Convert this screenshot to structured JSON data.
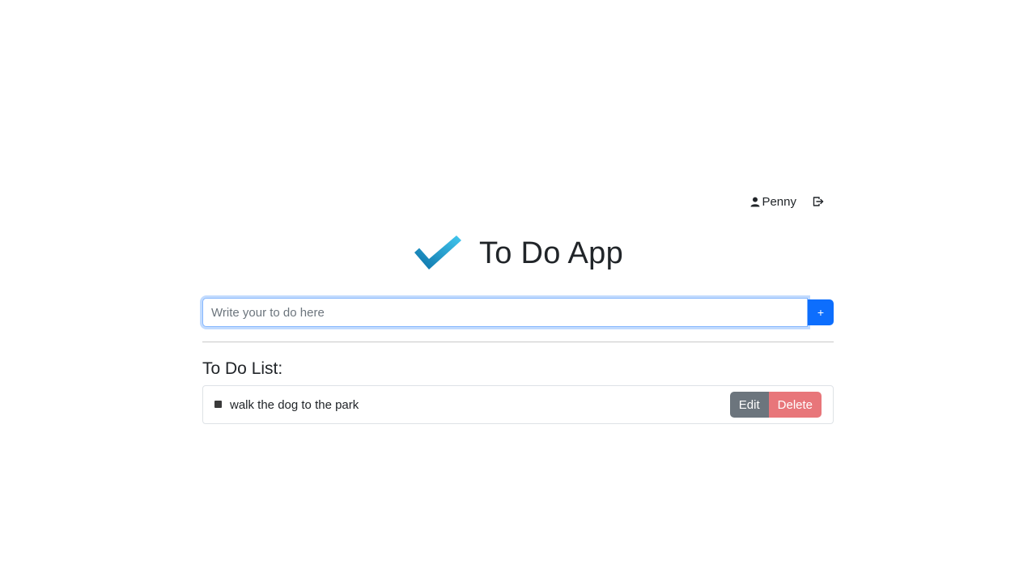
{
  "header": {
    "username": "Penny",
    "user_icon": "person-icon",
    "logout_icon": "logout-icon"
  },
  "app": {
    "title": "To Do App",
    "logo_icon": "checkmark-icon"
  },
  "new_todo": {
    "value": "",
    "placeholder": "Write your to do here",
    "add_label": "+"
  },
  "list": {
    "heading": "To Do List:",
    "items": [
      {
        "text": "walk the dog to the park",
        "done": false
      }
    ],
    "edit_label": "Edit",
    "delete_label": "Delete"
  },
  "colors": {
    "primary": "#0d6efd",
    "secondary": "#6c757d",
    "danger": "#e8767a",
    "logo_gradient_start": "#0a6fa6",
    "logo_gradient_end": "#42c8ef"
  }
}
